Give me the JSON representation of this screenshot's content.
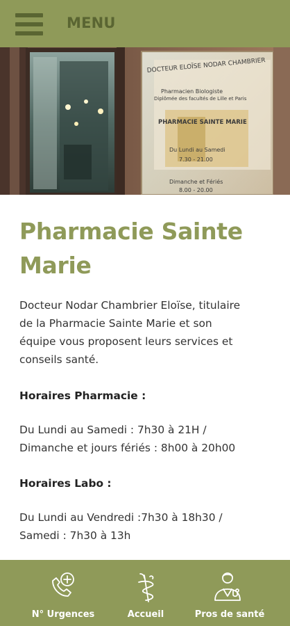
{
  "header": {
    "menu_label": "MENU",
    "menu_icon": "hamburger-icon"
  },
  "hero": {
    "image": "pharmacy-storefront-photo",
    "sign_lines": [
      "DOCTEUR ELOÏSE NODAR CHAMBRIER",
      "Pharmacien Biologiste",
      "Diplômée des facultés de Lille et Paris",
      "PHARMACIE SAINTE MARIE",
      "Du Lundi au Samedi",
      "7.30 - 21.00",
      "Dimanche et Fériés",
      "8.00 - 20.00"
    ]
  },
  "content": {
    "title_line1": "Pharmacie Sainte",
    "title_line2": "Marie",
    "intro_lines": [
      "Docteur Nodar Chambrier Eloïse, titulaire",
      "de la Pharmacie Sainte Marie et son",
      "équipe vous proposent leurs services et",
      "conseils santé."
    ],
    "pharmacy_hours_title": "Horaires Pharmacie :",
    "pharmacy_hours_lines": [
      "Du Lundi au Samedi : 7h30 à 21H /",
      "Dimanche et jours fériés : 8h00 à 20h00"
    ],
    "lab_hours_title": "Horaires Labo :",
    "lab_hours_lines": [
      "Du Lundi au Vendredi :7h30 à 18h30 /",
      "Samedi : 7h30 à 13h"
    ]
  },
  "bottom_nav": [
    {
      "label": "N° Urgences",
      "icon": "emergency-phone-icon"
    },
    {
      "label": "Accueil",
      "icon": "caduceus-icon"
    },
    {
      "label": "Pros de santé",
      "icon": "doctor-icon"
    }
  ],
  "colors": {
    "brand": "#8f9a59",
    "brand_dark": "#5a6532",
    "text": "#333333",
    "nav_text": "#ffffff"
  }
}
